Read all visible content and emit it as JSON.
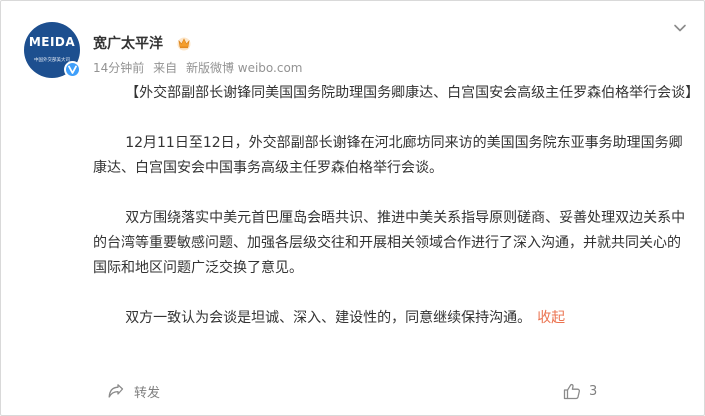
{
  "account": {
    "avatar_logo_text": "MEIDA",
    "avatar_sub_text": "中国外交部美大司",
    "username": "宽广太平洋",
    "crown_icon": "crown-icon",
    "verified_icon": "verified-badge-icon"
  },
  "meta": {
    "time": "14分钟前",
    "source_prefix": "来自",
    "source": "新版微博 weibo.com"
  },
  "post": {
    "title": "【外交部副部长谢锋同美国国务院助理国务卿康达、白宫国安会高级主任罗森伯格举行会谈】",
    "paragraphs": [
      "12月11日至12日，外交部副部长谢锋在河北廊坊同来访的美国国务院东亚事务助理国务卿康达、白宫国安会中国事务高级主任罗森伯格举行会谈。",
      "双方围绕落实中美元首巴厘岛会晤共识、推进中美关系指导原则磋商、妥善处理双边关系中的台湾等重要敏感问题、加强各层级交往和开展相关领域合作进行了深入沟通，并就共同关心的国际和地区问题广泛交换了意见。",
      "双方一致认为会谈是坦诚、深入、建设性的，同意继续保持沟通。"
    ],
    "collapse_label": "收起"
  },
  "actions": {
    "forward_label": "转发",
    "like_count": "3"
  },
  "colors": {
    "link": "#eb7350",
    "text": "#333333",
    "meta": "#939393",
    "avatar_bg": "#1d4f8f",
    "verified": "#3f9ffa"
  }
}
